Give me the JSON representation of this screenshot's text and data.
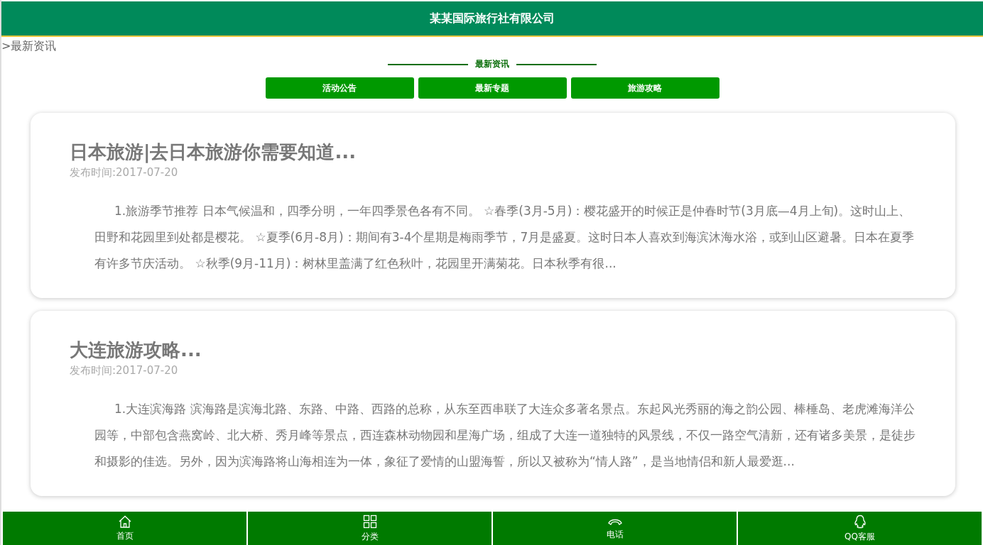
{
  "header": {
    "title": "某某国际旅行社有限公司"
  },
  "breadcrumb": ">最新资讯",
  "section": {
    "title": "最新资讯"
  },
  "category_buttons": [
    "活动公告",
    "最新专题",
    "旅游攻略"
  ],
  "articles": [
    {
      "title": "日本旅游|去日本旅游你需要知道...",
      "date": "发布时间:2017-07-20",
      "summary": "1.旅游季节推荐 日本气候温和，四季分明，一年四季景色各有不同。 ☆春季(3月-5月)：樱花盛开的时候正是仲春时节(3月底—4月上旬)。这时山上、田野和花园里到处都是樱花。 ☆夏季(6月-8月)：期间有3-4个星期是梅雨季节，7月是盛夏。这时日本人喜欢到海滨沐海水浴，或到山区避暑。日本在夏季有许多节庆活动。 ☆秋季(9月-11月)：树林里盖满了红色秋叶，花园里开满菊花。日本秋季有很..."
    },
    {
      "title": "大连旅游攻略...",
      "date": "发布时间:2017-07-20",
      "summary": "1.大连滨海路 滨海路是滨海北路、东路、中路、西路的总称，从东至西串联了大连众多著名景点。东起风光秀丽的海之韵公园、棒棰岛、老虎滩海洋公园等，中部包含燕窝岭、北大桥、秀月峰等景点，西连森林动物园和星海广场，组成了大连一道独特的风景线，不仅一路空气清新，还有诸多美景，是徒步和摄影的佳选。另外，因为滨海路将山海相连为一体，象征了爱情的山盟海誓，所以又被称为“情人路”，是当地情侣和新人最爱逛..."
    }
  ],
  "bottom_nav": [
    {
      "kind": "home",
      "label": "首页"
    },
    {
      "kind": "grid",
      "label": "分类"
    },
    {
      "kind": "phone",
      "label": "电话"
    },
    {
      "kind": "qq",
      "label": "QQ客服"
    }
  ]
}
